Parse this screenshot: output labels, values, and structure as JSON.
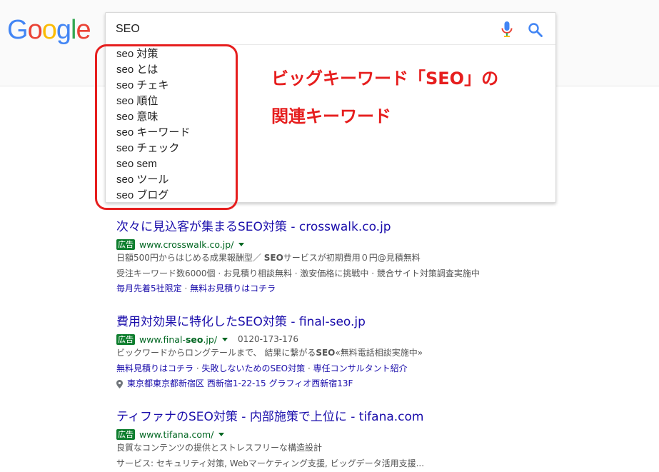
{
  "logo": {
    "letters": [
      "G",
      "o",
      "o",
      "g",
      "l",
      "e"
    ],
    "colors": [
      "#4285F4",
      "#EA4335",
      "#FBBC05",
      "#4285F4",
      "#34A853",
      "#EA4335"
    ]
  },
  "search": {
    "query": "SEO",
    "suggestions": [
      "seo 対策",
      "seo とは",
      "seo チェキ",
      "seo 順位",
      "seo 意味",
      "seo キーワード",
      "seo チェック",
      "seo sem",
      "seo ツール",
      "seo ブログ"
    ]
  },
  "annotation": {
    "line1": "ビッグキーワード「SEO」の",
    "line2": "関連キーワード",
    "color": "#e61e1e"
  },
  "results": [
    {
      "title": "次々に見込客が集まるSEO対策 - crosswalk.co.jp",
      "ad_label": "広告",
      "url": "www.crosswalk.co.jp/",
      "desc1_a": "日額500円からはじめる成果報酬型／ ",
      "desc1_b": "SEO",
      "desc1_c": "サービスが初期費用０円@見積無料",
      "desc2": "受注キーワード数6000個 · お見積り相談無料 · 激安価格に挑戦中 · 競合サイト対策調査実施中",
      "link1": "毎月先着5社限定",
      "link2": "無料お見積りはコチラ"
    },
    {
      "title": "費用対効果に特化したSEO対策 - final-seo.jp",
      "ad_label": "広告",
      "url_a": "www.final-",
      "url_b": "seo",
      "url_c": ".jp/",
      "phone": "0120-173-176",
      "desc1_a": "ビックワードからロングテールまで、 結果に繋がる",
      "desc1_b": "SEO",
      "desc1_c": "«無料電話相談実施中»",
      "link1": "無料見積りはコチラ",
      "link2": "失敗しないためのSEO対策",
      "link3": "専任コンサルタント紹介",
      "address": "東京都東京都新宿区 西新宿1-22-15 グラフィオ西新宿13F"
    },
    {
      "title": "ティファナのSEO対策 - 内部施策で上位に - tifana.com",
      "ad_label": "広告",
      "url": "www.tifana.com/",
      "desc1": "良質なコンテンツの提供とストレスフリーな構造設計",
      "desc2": "サービス: セキュリティ対策, Webマーケティング支援, ビッグデータ活用支援..."
    }
  ],
  "separator": " · "
}
